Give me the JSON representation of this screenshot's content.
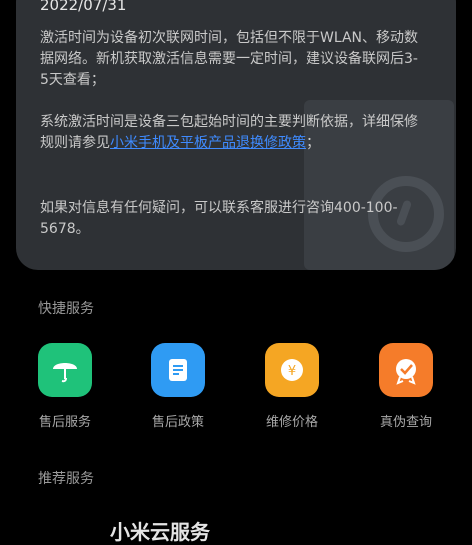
{
  "device_info": {
    "activation_date": "2022/07/31",
    "activation_note": "激活时间为设备初次联网时间，包括但不限于WLAN、移动数据网络。新机获取激活信息需要一定时间，建议设备联网后3-5天查看；",
    "warranty_note_prefix": "系统激活时间是设备三包起始时间的主要判断依据，详细保修规则请参见",
    "warranty_link": "小米手机及平板产品退换修政策",
    "warranty_note_suffix": "；",
    "contact_note": "如果对信息有任何疑问，可以联系客服进行咨询400-100-5678。"
  },
  "quick_services": {
    "title": "快捷服务",
    "items": [
      {
        "label": "售后服务",
        "icon": "umbrella-icon",
        "color": "#1fc27a"
      },
      {
        "label": "售后政策",
        "icon": "document-icon",
        "color": "#2f9bf3"
      },
      {
        "label": "维修价格",
        "icon": "yen-coin-icon",
        "color": "#f5a623"
      },
      {
        "label": "真伪查询",
        "icon": "verified-badge-icon",
        "color": "#f57c2a"
      }
    ]
  },
  "recommended_services": {
    "title": "推荐服务",
    "first_item_title": "小米云服务"
  }
}
